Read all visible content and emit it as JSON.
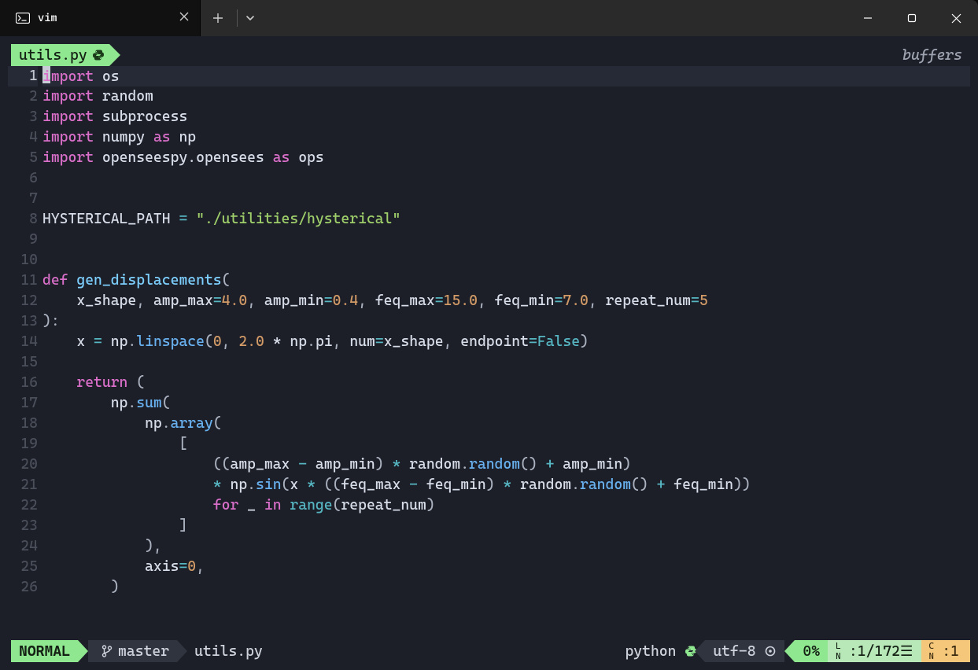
{
  "window": {
    "tab_title": "vim"
  },
  "buffer": {
    "name": "utils.py",
    "label_right": "buffers"
  },
  "code": {
    "cursor_line": 1,
    "lines": [
      [
        [
          "cursor",
          ""
        ],
        [
          "kw",
          "import"
        ],
        [
          "",
          ""
        ],
        [
          "id",
          " os"
        ]
      ],
      [
        [
          "kw",
          "import"
        ],
        [
          "id",
          " random"
        ]
      ],
      [
        [
          "kw",
          "import"
        ],
        [
          "id",
          " subprocess"
        ]
      ],
      [
        [
          "kw",
          "import"
        ],
        [
          "id",
          " numpy "
        ],
        [
          "kw",
          "as"
        ],
        [
          "id",
          " np"
        ]
      ],
      [
        [
          "kw",
          "import"
        ],
        [
          "id",
          " openseespy.opensees "
        ],
        [
          "kw",
          "as"
        ],
        [
          "id",
          " ops"
        ]
      ],
      [],
      [],
      [
        [
          "id",
          "HYSTERICAL_PATH "
        ],
        [
          "op",
          "="
        ],
        [
          "",
          ""
        ],
        [
          "str",
          " \"./utilities/hysterical\""
        ]
      ],
      [],
      [],
      [
        [
          "kw",
          "def "
        ],
        [
          "defname",
          "gen_displacements"
        ],
        [
          "punct",
          "("
        ]
      ],
      [
        [
          "",
          "    "
        ],
        [
          "id",
          "x_shape"
        ],
        [
          "punct",
          ", "
        ],
        [
          "id",
          "amp_max"
        ],
        [
          "op",
          "="
        ],
        [
          "num",
          "4.0"
        ],
        [
          "punct",
          ", "
        ],
        [
          "id",
          "amp_min"
        ],
        [
          "op",
          "="
        ],
        [
          "num",
          "0.4"
        ],
        [
          "punct",
          ", "
        ],
        [
          "id",
          "feq_max"
        ],
        [
          "op",
          "="
        ],
        [
          "num",
          "15.0"
        ],
        [
          "punct",
          ", "
        ],
        [
          "id",
          "feq_min"
        ],
        [
          "op",
          "="
        ],
        [
          "num",
          "7.0"
        ],
        [
          "punct",
          ", "
        ],
        [
          "id",
          "repeat_num"
        ],
        [
          "op",
          "="
        ],
        [
          "num",
          "5"
        ]
      ],
      [
        [
          "punct",
          ")"
        ],
        [
          "punct",
          ":"
        ]
      ],
      [
        [
          "",
          "    "
        ],
        [
          "id",
          "x "
        ],
        [
          "op",
          "="
        ],
        [
          "id",
          " np"
        ],
        [
          "punct",
          "."
        ],
        [
          "fn",
          "linspace"
        ],
        [
          "punct",
          "("
        ],
        [
          "num",
          "0"
        ],
        [
          "punct",
          ", "
        ],
        [
          "num",
          "2.0"
        ],
        [
          "id",
          " * np"
        ],
        [
          "punct",
          "."
        ],
        [
          "id",
          "pi"
        ],
        [
          "punct",
          ", "
        ],
        [
          "id",
          "num"
        ],
        [
          "op",
          "="
        ],
        [
          "id",
          "x_shape"
        ],
        [
          "punct",
          ", "
        ],
        [
          "id",
          "endpoint"
        ],
        [
          "op",
          "="
        ],
        [
          "bool",
          "False"
        ],
        [
          "punct",
          ")"
        ]
      ],
      [],
      [
        [
          "",
          "    "
        ],
        [
          "kw",
          "return"
        ],
        [
          "punct",
          " ("
        ]
      ],
      [
        [
          "",
          "        "
        ],
        [
          "id",
          "np"
        ],
        [
          "punct",
          "."
        ],
        [
          "fn",
          "sum"
        ],
        [
          "punct",
          "("
        ]
      ],
      [
        [
          "",
          "            "
        ],
        [
          "id",
          "np"
        ],
        [
          "punct",
          "."
        ],
        [
          "fn",
          "array"
        ],
        [
          "punct",
          "("
        ]
      ],
      [
        [
          "",
          "                "
        ],
        [
          "punct",
          "["
        ]
      ],
      [
        [
          "",
          "                    "
        ],
        [
          "punct",
          "(("
        ],
        [
          "id",
          "amp_max "
        ],
        [
          "op",
          "-"
        ],
        [
          "id",
          " amp_min"
        ],
        [
          "punct",
          ") "
        ],
        [
          "op",
          "*"
        ],
        [
          "id",
          " random"
        ],
        [
          "punct",
          "."
        ],
        [
          "fn",
          "random"
        ],
        [
          "punct",
          "() "
        ],
        [
          "op",
          "+"
        ],
        [
          "id",
          " amp_min"
        ],
        [
          "punct",
          ")"
        ]
      ],
      [
        [
          "",
          "                    "
        ],
        [
          "op",
          "*"
        ],
        [
          "id",
          " np"
        ],
        [
          "punct",
          "."
        ],
        [
          "fn",
          "sin"
        ],
        [
          "punct",
          "("
        ],
        [
          "id",
          "x "
        ],
        [
          "op",
          "*"
        ],
        [
          "punct",
          " (("
        ],
        [
          "id",
          "feq_max "
        ],
        [
          "op",
          "-"
        ],
        [
          "id",
          " feq_min"
        ],
        [
          "punct",
          ") "
        ],
        [
          "op",
          "*"
        ],
        [
          "id",
          " random"
        ],
        [
          "punct",
          "."
        ],
        [
          "fn",
          "random"
        ],
        [
          "punct",
          "() "
        ],
        [
          "op",
          "+"
        ],
        [
          "id",
          " feq_min"
        ],
        [
          "punct",
          "))"
        ]
      ],
      [
        [
          "",
          "                    "
        ],
        [
          "kw",
          "for"
        ],
        [
          "id",
          " _ "
        ],
        [
          "kw",
          "in"
        ],
        [
          "",
          ""
        ],
        [
          "",
          ""
        ],
        [
          "",
          ""
        ],
        [
          "",
          ""
        ],
        [
          "",
          ""
        ],
        [
          "",
          ""
        ],
        [
          "",
          ""
        ],
        [
          "",
          ""
        ],
        [
          "",
          ""
        ],
        [
          "",
          ""
        ],
        [
          "",
          ""
        ],
        [
          "",
          ""
        ],
        [
          "",
          ""
        ],
        [
          "",
          ""
        ],
        [
          "",
          ""
        ],
        [
          "",
          ""
        ],
        [
          "",
          ""
        ],
        [
          "",
          ""
        ],
        [
          "",
          ""
        ],
        [
          "",
          ""
        ],
        [
          "",
          ""
        ],
        [
          "",
          ""
        ],
        [
          "",
          ""
        ],
        [
          "",
          ""
        ],
        [
          "",
          ""
        ],
        [
          "",
          " "
        ],
        [
          "builtin",
          "range"
        ],
        [
          "punct",
          "("
        ],
        [
          "id",
          "repeat_num"
        ],
        [
          "punct",
          ")"
        ]
      ],
      [
        [
          "",
          "                "
        ],
        [
          "punct",
          "]"
        ]
      ],
      [
        [
          "",
          "            "
        ],
        [
          "punct",
          ")"
        ],
        [
          "punct",
          ","
        ]
      ],
      [
        [
          "",
          "            "
        ],
        [
          "id",
          "axis"
        ],
        [
          "op",
          "="
        ],
        [
          "num",
          "0"
        ],
        [
          "punct",
          ","
        ]
      ],
      [
        [
          "",
          "        "
        ],
        [
          "punct",
          ")"
        ]
      ]
    ]
  },
  "status": {
    "mode": "NORMAL",
    "branch": "master",
    "filename": "utils.py",
    "filetype": "python",
    "encoding": "utf-8",
    "percent": "0%",
    "line": "1",
    "total_lines": "172",
    "col": "1"
  }
}
